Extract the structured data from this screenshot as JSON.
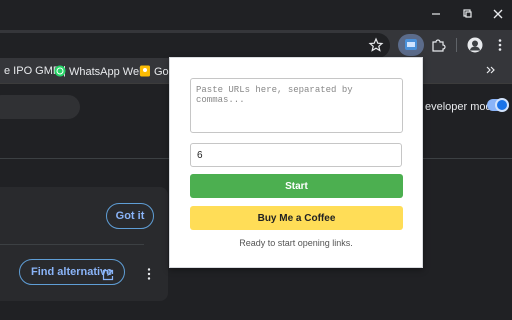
{
  "browser": {
    "icons": [
      "minimize-icon",
      "maximize-icon",
      "close-icon",
      "bookmark-star-icon",
      "extension-active-icon",
      "extensions-puzzle-icon",
      "profile-avatar-icon",
      "more-menu-icon",
      "more-bookmarks-icon"
    ],
    "accent": "#8ab4f8"
  },
  "bookmarks": {
    "items": [
      {
        "label": "e IPO GMP |"
      },
      {
        "label": "WhatsApp Web"
      },
      {
        "label": "Goo"
      }
    ]
  },
  "page": {
    "developer_mode_label": "eveloper mode",
    "developer_mode_on": true,
    "got_it_label": "Got it",
    "find_alternative_label": "Find alternative"
  },
  "popup": {
    "urls_placeholder": "Paste URLs here, separated by commas...",
    "urls_value": "",
    "count_value": "6",
    "start_label": "Start",
    "coffee_label": "Buy Me a Coffee",
    "status_text": "Ready to start opening links.",
    "colors": {
      "start": "#4caf50",
      "coffee": "#ffdd57"
    }
  }
}
